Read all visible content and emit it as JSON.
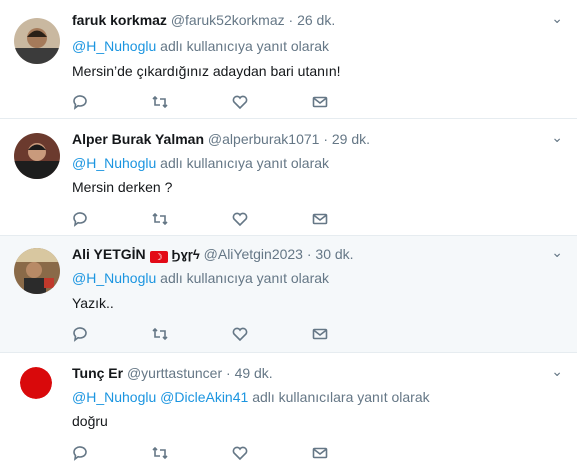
{
  "tweets": [
    {
      "name": "faruk korkmaz",
      "handle": "@faruk52korkmaz",
      "time": "26 dk.",
      "reply_mention": "@H_Nuhoglu",
      "reply_mention2": "",
      "reply_suffix": "adlı kullanıcıya yanıt olarak",
      "text": "Mersin’de çıkardığınız adaydan bari utanın!"
    },
    {
      "name": "Alper Burak Yalman",
      "handle": "@alperburak1071",
      "time": "29 dk.",
      "reply_mention": "@H_Nuhoglu",
      "reply_mention2": "",
      "reply_suffix": "adlı kullanıcıya yanıt olarak",
      "text": "Mersin derken ?"
    },
    {
      "name": "Ali YETGİN",
      "name_extra": "Ϧɣɼϟ",
      "handle": "@AliYetgin2023",
      "time": "30 dk.",
      "reply_mention": "@H_Nuhoglu",
      "reply_mention2": "",
      "reply_suffix": "adlı kullanıcıya yanıt olarak",
      "text": "Yazık.."
    },
    {
      "name": "Tunç Er",
      "handle": "@yurttastuncer",
      "time": "49 dk.",
      "reply_mention": "@H_Nuhoglu",
      "reply_mention2": "@DicleAkin41",
      "reply_suffix": "adlı kullanıcılara yanıt olarak",
      "text": "doğru"
    }
  ],
  "separator": "·",
  "colors": {
    "link": "#1b95e0",
    "muted": "#657786",
    "highlight_bg": "#f5f8fa"
  }
}
